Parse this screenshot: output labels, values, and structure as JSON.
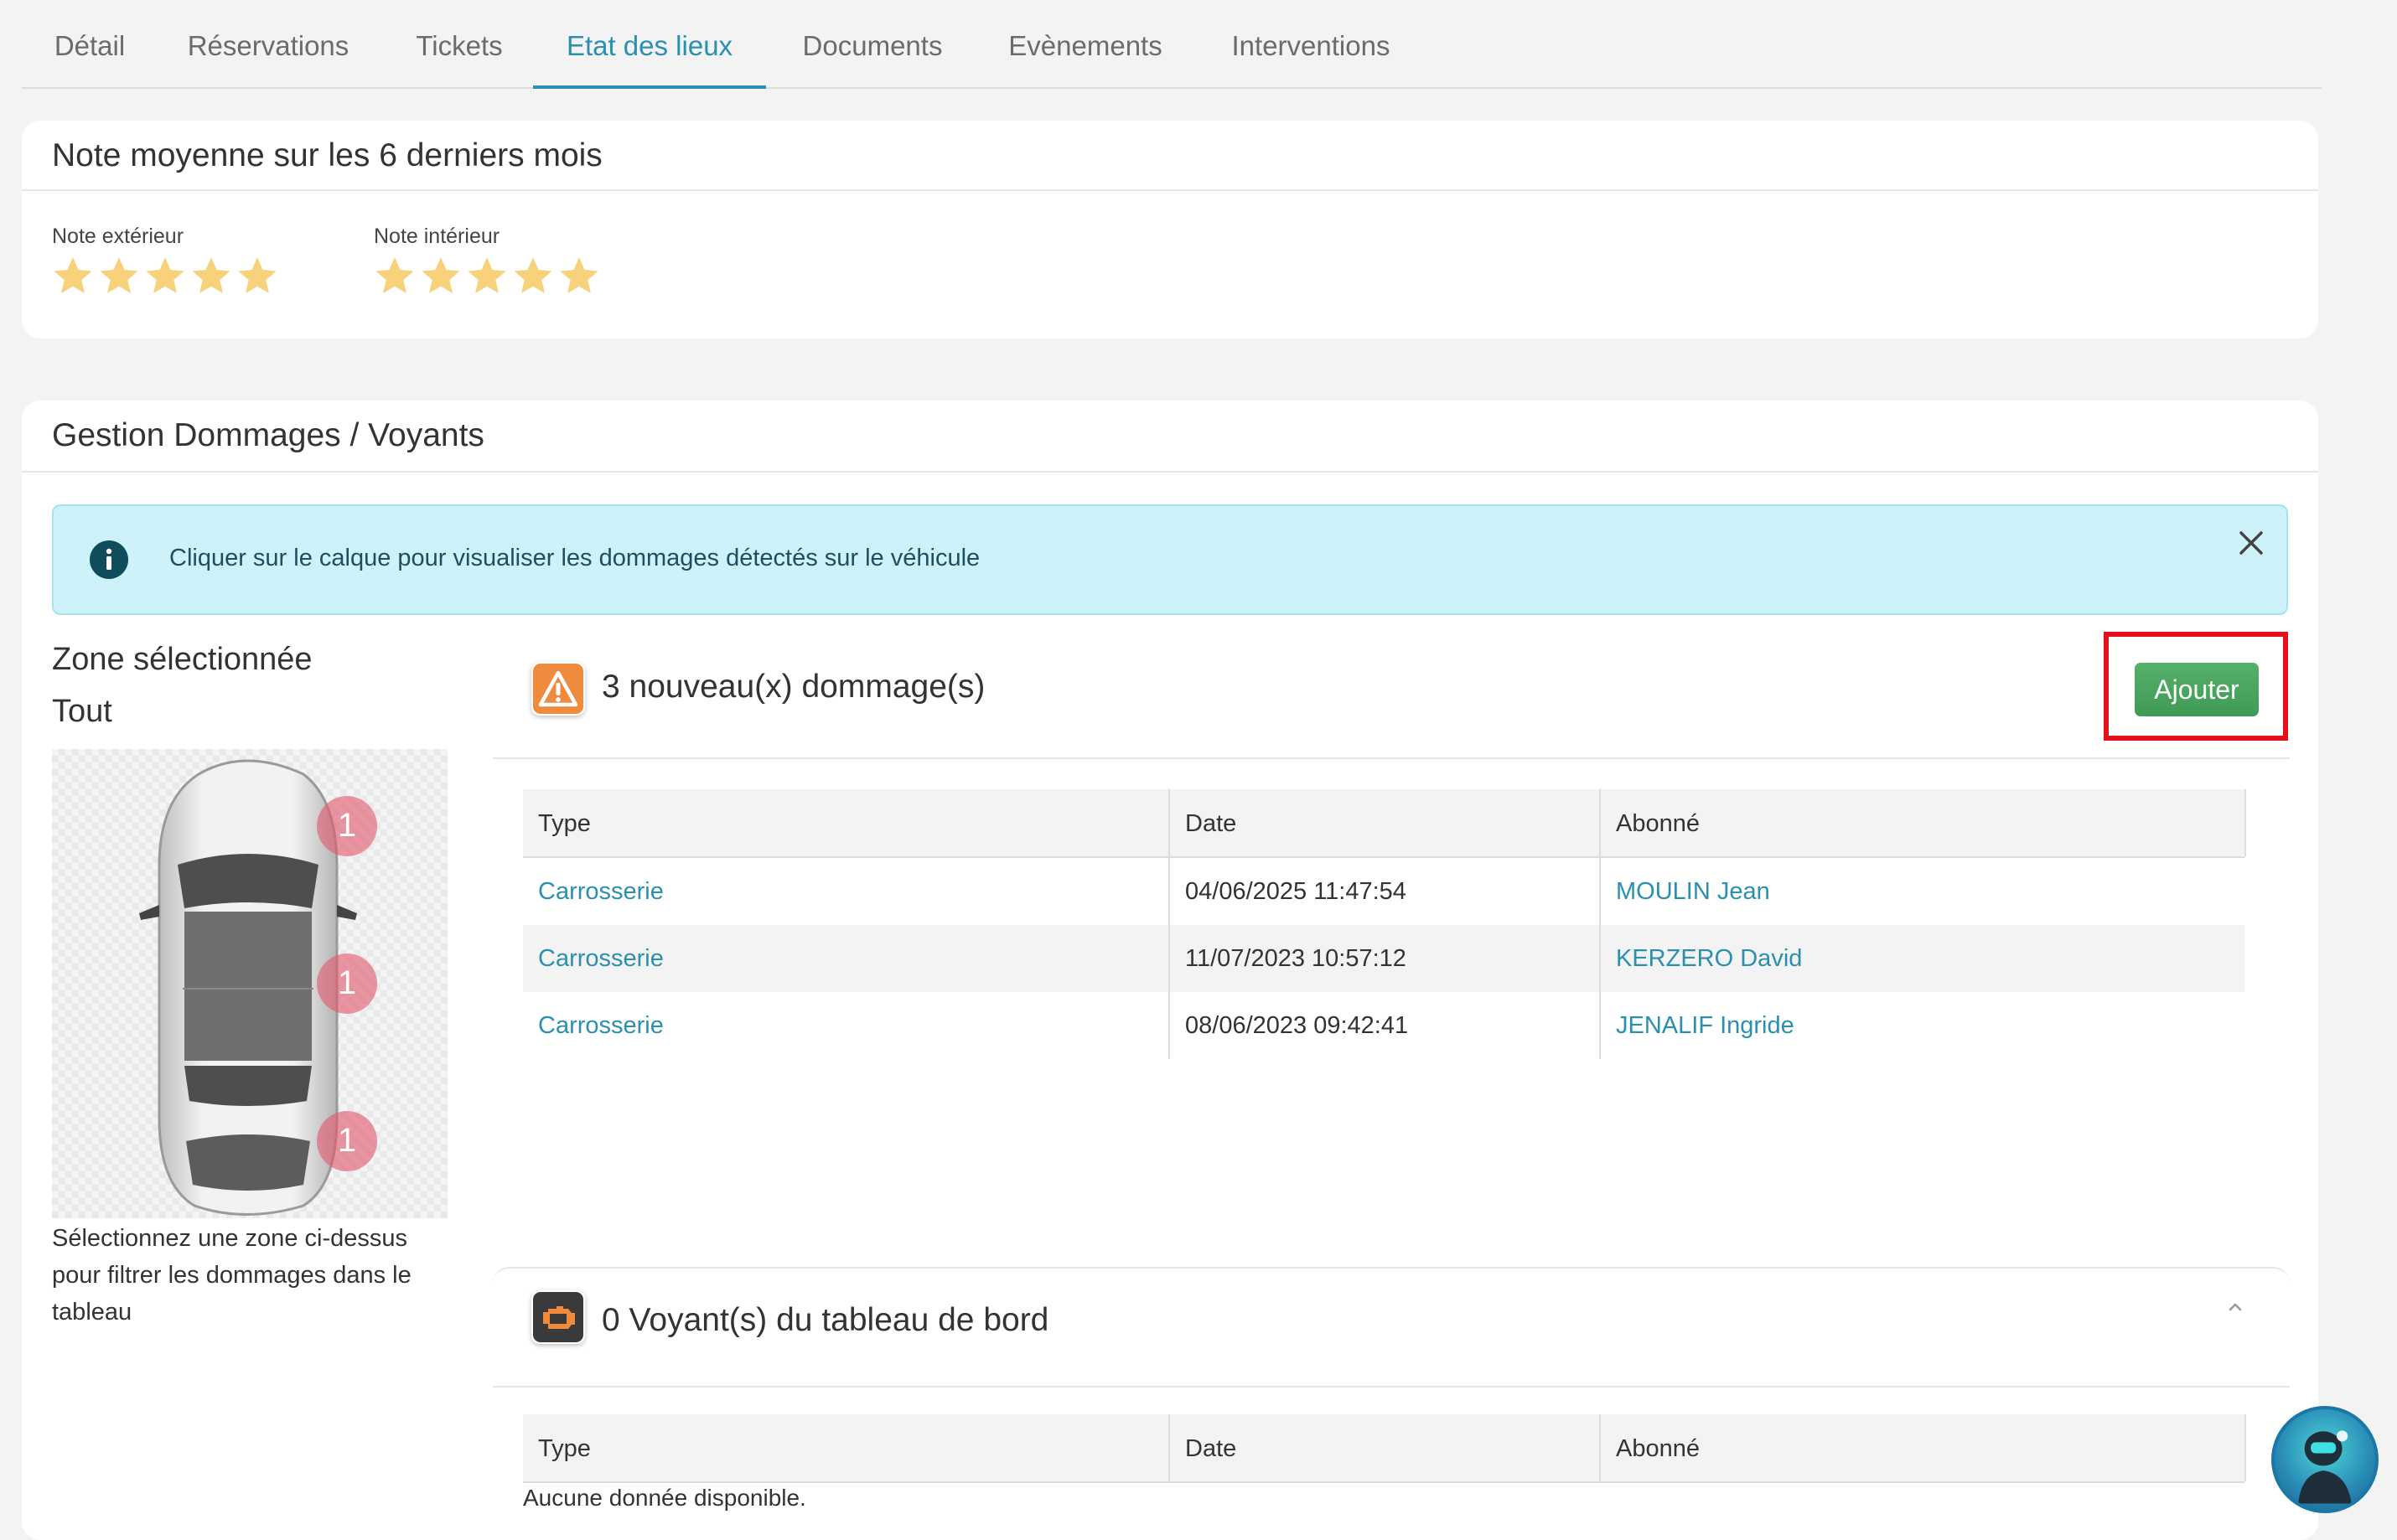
{
  "tabs": [
    {
      "label": "Détail"
    },
    {
      "label": "Réservations"
    },
    {
      "label": "Tickets"
    },
    {
      "label": "Etat des lieux"
    },
    {
      "label": "Documents"
    },
    {
      "label": "Evènements"
    },
    {
      "label": "Interventions"
    }
  ],
  "active_tab": "Etat des lieux",
  "rating": {
    "title": "Note moyenne sur les 6 derniers mois",
    "exterior": {
      "label": "Note extérieur",
      "stars": 5,
      "max": 5
    },
    "interior": {
      "label": "Note intérieur",
      "stars": 5,
      "max": 5
    },
    "star_color": "#f7d27a"
  },
  "damage_mgmt": {
    "title": "Gestion Dommages / Voyants",
    "alert_text": "Cliquer sur le calque pour visualiser les dommages détectés sur le véhicule",
    "zone_heading": "Zone sélectionnée",
    "zone_value": "Tout",
    "zone_markers": [
      "1",
      "1",
      "1"
    ],
    "zone_help": "Sélectionnez une zone ci-dessus pour filtrer les dommages dans le tableau"
  },
  "damages": {
    "title": "3 nouveau(x) dommage(s)",
    "add_button": "Ajouter",
    "columns": [
      "Type",
      "Date",
      "Abonné"
    ],
    "rows": [
      {
        "type": "Carrosserie",
        "date": "04/06/2025 11:47:54",
        "subscriber": "MOULIN Jean"
      },
      {
        "type": "Carrosserie",
        "date": "11/07/2023 10:57:12",
        "subscriber": "KERZERO David"
      },
      {
        "type": "Carrosserie",
        "date": "08/06/2023 09:42:41",
        "subscriber": "JENALIF Ingride"
      }
    ]
  },
  "warnings": {
    "title": "0 Voyant(s) du tableau de bord",
    "columns": [
      "Type",
      "Date",
      "Abonné"
    ],
    "empty_text": "Aucune donnée disponible."
  },
  "colors": {
    "accent": "#2b8fb0",
    "add_button": "#4aa55f",
    "highlight": "#e5101a",
    "alert_bg": "#cdf2fa",
    "warning_icon": "#f08a3c"
  }
}
